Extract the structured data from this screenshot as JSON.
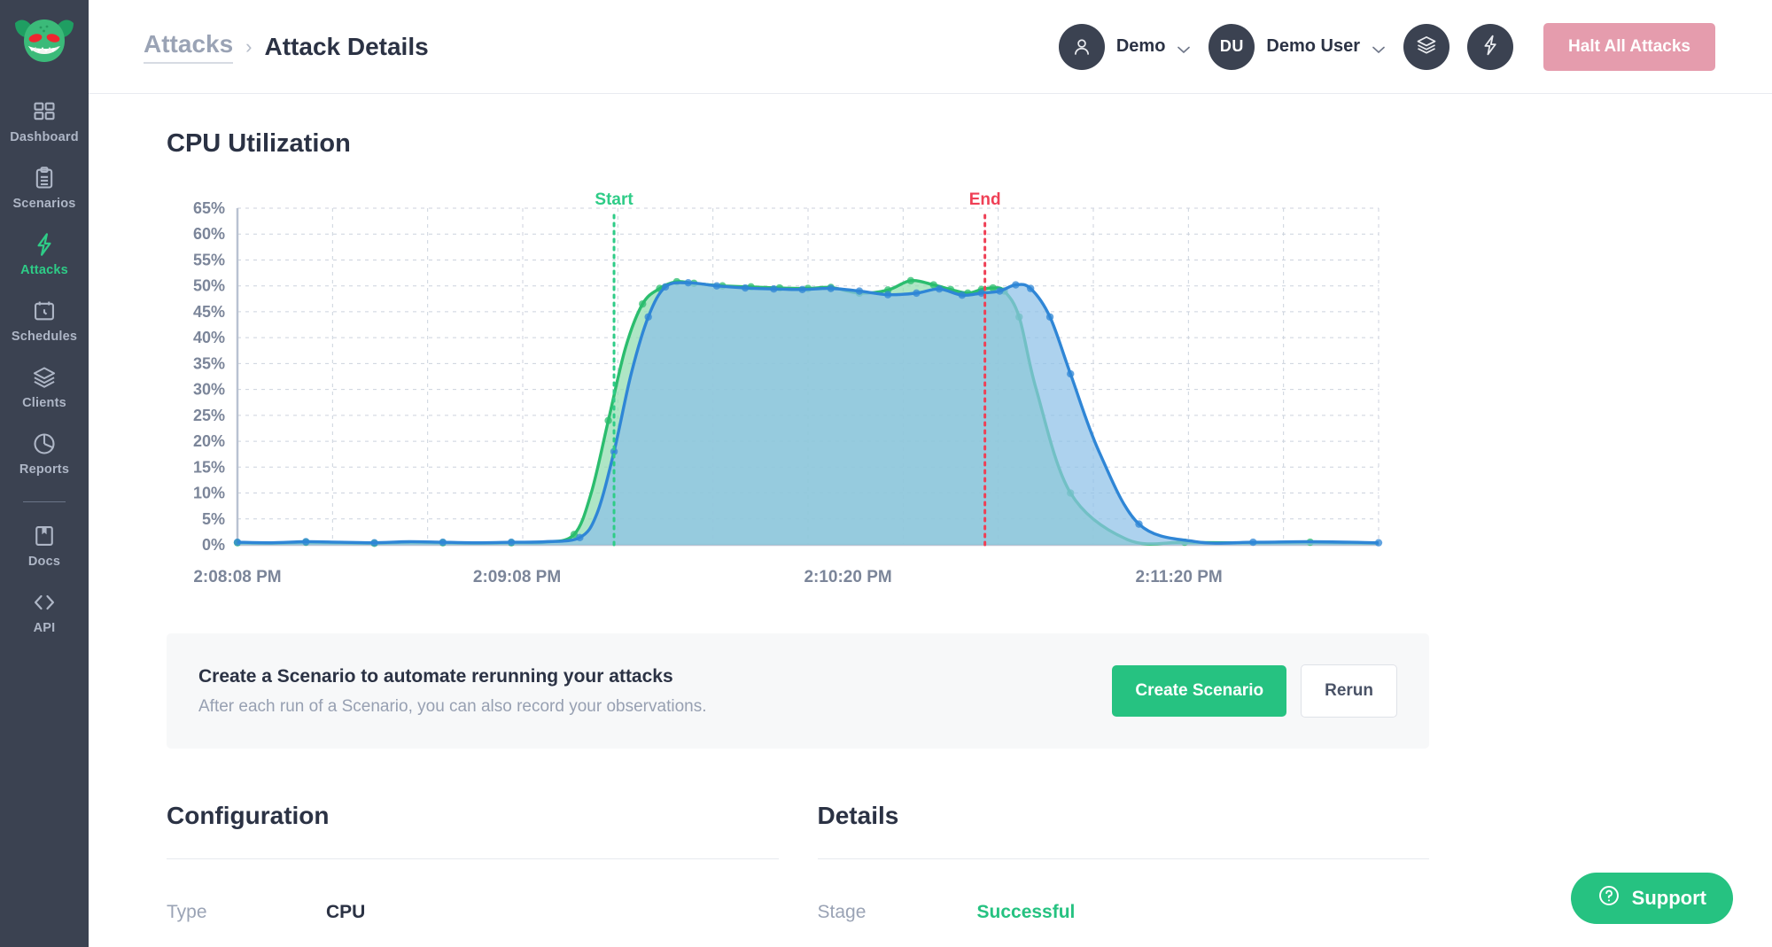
{
  "brand": {
    "logo_icon": "gremlin-mascot-logo",
    "accent": "#26c281",
    "sidebar_bg": "#3b4251"
  },
  "sidebar": {
    "items": [
      {
        "label": "Dashboard",
        "icon": "grid-icon",
        "active": false
      },
      {
        "label": "Scenarios",
        "icon": "clipboard-icon",
        "active": false
      },
      {
        "label": "Attacks",
        "icon": "bolt-icon",
        "active": true
      },
      {
        "label": "Schedules",
        "icon": "calendar-clock-icon",
        "active": false
      },
      {
        "label": "Clients",
        "icon": "layers-icon",
        "active": false
      },
      {
        "label": "Reports",
        "icon": "pie-chart-icon",
        "active": false
      },
      {
        "label": "Docs",
        "icon": "book-icon",
        "active": false
      },
      {
        "label": "API",
        "icon": "code-brackets-icon",
        "active": false
      }
    ]
  },
  "header": {
    "breadcrumb_parent": "Attacks",
    "breadcrumb_separator": "›",
    "breadcrumb_current": "Attack Details",
    "org": {
      "name": "Demo",
      "avatar_icon": "person-silhouette-icon",
      "chevron_icon": "chevron-down-icon"
    },
    "user": {
      "name": "Demo User",
      "initials": "DU",
      "chevron_icon": "chevron-down-icon"
    },
    "icon_buttons": [
      {
        "name": "layers-icon"
      },
      {
        "name": "bolt-icon"
      }
    ],
    "halt_button": {
      "label": "Halt All Attacks",
      "color": "#e59cad"
    }
  },
  "chart_data": {
    "type": "area",
    "title": "CPU Utilization",
    "xlabel": "",
    "ylabel": "",
    "ylim": [
      0,
      65
    ],
    "yticks": [
      "0%",
      "5%",
      "10%",
      "15%",
      "20%",
      "25%",
      "30%",
      "35%",
      "40%",
      "45%",
      "50%",
      "55%",
      "60%",
      "65%"
    ],
    "ytick_values": [
      0,
      5,
      10,
      15,
      20,
      25,
      30,
      35,
      40,
      45,
      50,
      55,
      60,
      65
    ],
    "xticks": [
      "2:08:08 PM",
      "2:09:08 PM",
      "2:10:20 PM",
      "2:11:20 PM"
    ],
    "xtick_positions": [
      0,
      0.245,
      0.535,
      0.825
    ],
    "grid": true,
    "legend_position": "none",
    "annotations": [
      {
        "label": "Start",
        "x": 0.33,
        "color": "#2ecc87",
        "style": "dashed-vertical"
      },
      {
        "label": "End",
        "x": 0.655,
        "color": "#ef4056",
        "style": "dashed-vertical"
      }
    ],
    "series": [
      {
        "name": "series-green",
        "color": "#2bbd6e",
        "fill": "#8fdcaf",
        "x": [
          0.0,
          0.03,
          0.06,
          0.09,
          0.12,
          0.15,
          0.18,
          0.21,
          0.24,
          0.27,
          0.295,
          0.31,
          0.325,
          0.34,
          0.355,
          0.37,
          0.385,
          0.4,
          0.425,
          0.45,
          0.475,
          0.5,
          0.52,
          0.545,
          0.57,
          0.59,
          0.61,
          0.625,
          0.64,
          0.652,
          0.662,
          0.672,
          0.685,
          0.7,
          0.73,
          0.78,
          0.83,
          0.88,
          0.94,
          1.0
        ],
        "y": [
          0.4,
          0.3,
          0.5,
          0.4,
          0.3,
          0.5,
          0.4,
          0.3,
          0.4,
          0.5,
          2.0,
          10.0,
          24.0,
          38.0,
          46.5,
          49.5,
          50.8,
          50.5,
          50.0,
          49.8,
          49.6,
          49.5,
          49.7,
          48.6,
          49.2,
          51.0,
          50.2,
          49.3,
          48.6,
          49.3,
          49.6,
          49.0,
          44.0,
          30.0,
          10.0,
          1.0,
          0.5,
          0.4,
          0.5,
          0.3
        ]
      },
      {
        "name": "series-blue",
        "color": "#2f86d6",
        "fill": "#8ec0e8",
        "x": [
          0.0,
          0.03,
          0.06,
          0.09,
          0.12,
          0.15,
          0.18,
          0.21,
          0.24,
          0.27,
          0.3,
          0.315,
          0.33,
          0.345,
          0.36,
          0.375,
          0.395,
          0.42,
          0.445,
          0.47,
          0.495,
          0.52,
          0.545,
          0.57,
          0.595,
          0.615,
          0.635,
          0.652,
          0.668,
          0.682,
          0.695,
          0.712,
          0.73,
          0.755,
          0.79,
          0.84,
          0.89,
          0.94,
          1.0
        ],
        "y": [
          0.5,
          0.4,
          0.6,
          0.5,
          0.4,
          0.6,
          0.5,
          0.4,
          0.5,
          0.6,
          1.4,
          6.0,
          18.0,
          33.0,
          44.0,
          49.8,
          50.6,
          50.0,
          49.6,
          49.4,
          49.3,
          49.5,
          49.0,
          48.3,
          48.6,
          49.4,
          48.2,
          48.6,
          49.0,
          50.2,
          49.5,
          44.0,
          33.0,
          18.0,
          4.0,
          0.6,
          0.5,
          0.6,
          0.4
        ]
      }
    ]
  },
  "banner": {
    "heading": "Create a Scenario to automate rerunning your attacks",
    "subtext": "After each run of a Scenario, you can also record your observations.",
    "primary_label": "Create Scenario",
    "secondary_label": "Rerun"
  },
  "configuration": {
    "heading": "Configuration",
    "rows": [
      {
        "key": "Type",
        "value": "CPU"
      }
    ]
  },
  "details": {
    "heading": "Details",
    "rows": [
      {
        "key": "Stage",
        "value": "Successful",
        "status": "ok"
      }
    ]
  },
  "support": {
    "label": "Support",
    "icon": "question-circle-icon"
  }
}
